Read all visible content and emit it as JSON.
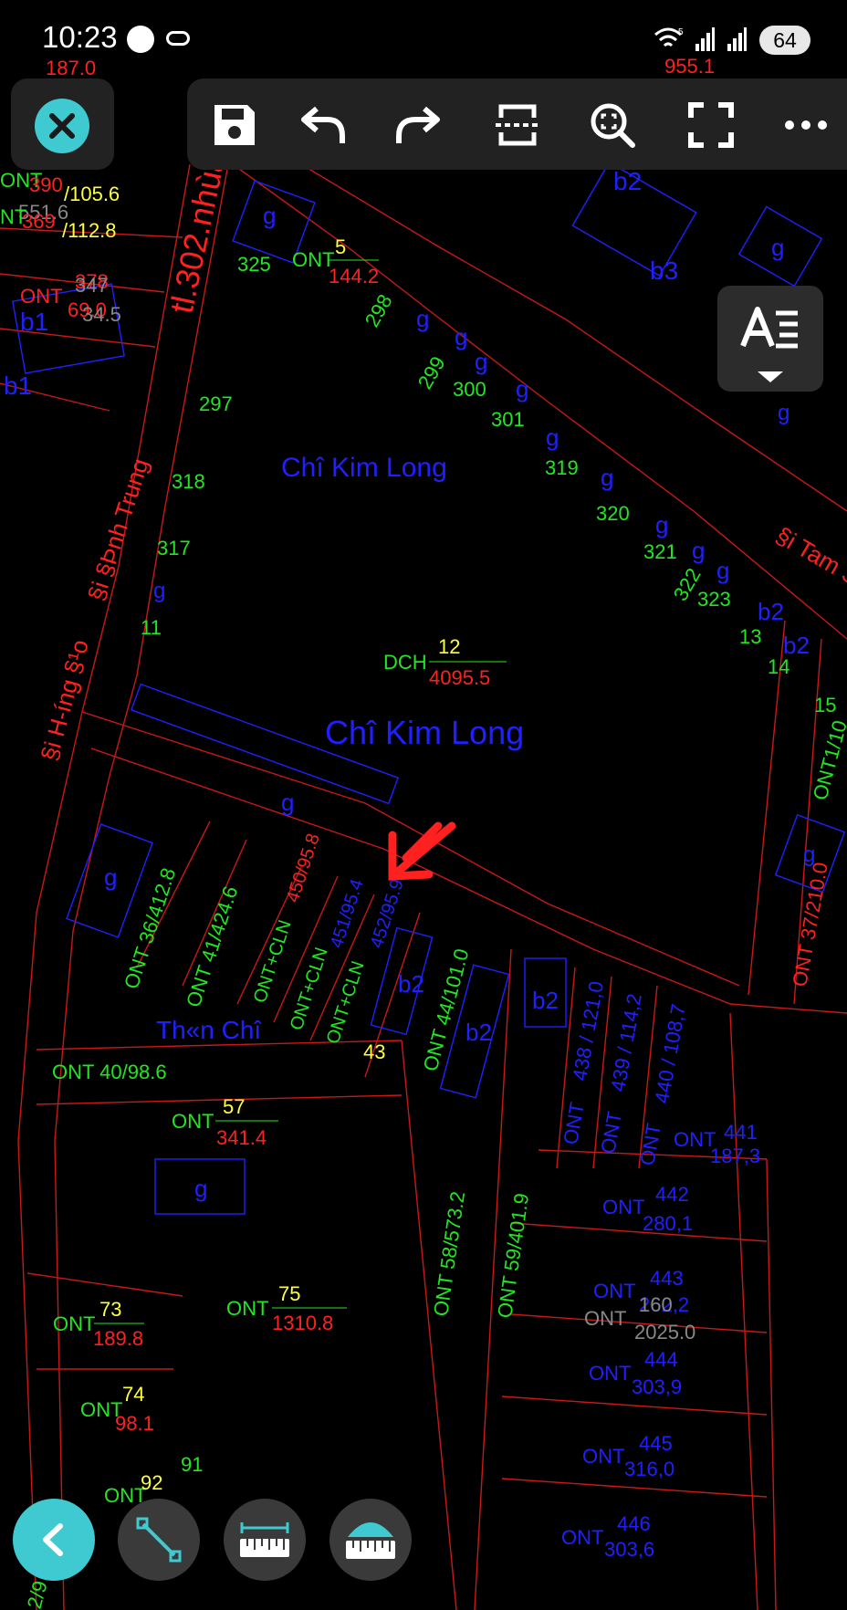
{
  "status_bar": {
    "time": "10:23",
    "battery": "64",
    "wifi_label": "5"
  },
  "toolbar": {
    "close": "close-icon",
    "save": "save-icon",
    "undo": "undo-icon",
    "redo": "redo-icon",
    "section": "section-icon",
    "zoom": "zoom-extents-icon",
    "fullscreen": "fullscreen-icon",
    "more": "more-icon"
  },
  "side_tools": {
    "text_style": "text-style-icon"
  },
  "bottom_tools": {
    "back": "back-icon",
    "line": "measure-line-icon",
    "distance": "measure-distance-icon",
    "area": "measure-area-icon"
  },
  "colors": {
    "accent": "#3fc9d0",
    "red_line": "#c81818",
    "blue": "#2020ff",
    "green": "#22e622",
    "red": "#ff2020",
    "yellow": "#ffff40"
  },
  "map": {
    "labels": {
      "top_cut_left": "187.0",
      "top_cut_right": "955.1",
      "ont_390": "ONT",
      "n390": "390",
      "a105": "/105.6",
      "n551": "551.6",
      "nt_left": "NT",
      "n369": "369",
      "a112": "/112.8",
      "ont_378": "ONT",
      "n378": "378",
      "n347": "347",
      "a69": "69.0",
      "n34_5": "34.5",
      "b1_a": "b1",
      "b1_b": "b1",
      "g_top": "g",
      "n325": "325",
      "ont5": "ONT",
      "n5": "5",
      "a144": "144.2",
      "road_302": "tl.302.nhùa",
      "n298": "298",
      "g298": "g",
      "n299": "299",
      "g299": "g",
      "n300": "300",
      "g300": "g",
      "n301": "301",
      "g301": "g",
      "n319": "319",
      "g319": "g",
      "n320": "320",
      "g320": "g",
      "n321": "321",
      "g321": "g",
      "n322": "322",
      "g322": "g",
      "n323": "323",
      "g323": "g",
      "b2_top": "b2",
      "b3": "b3",
      "g_b3": "g",
      "g_right": "g",
      "n297": "297",
      "chi_kim_long_1": "Chî Kim Long",
      "n318": "318",
      "n317": "317",
      "road_dinh_trung": "§i §Þnh Trung",
      "g11": "g",
      "n11": "11",
      "road_huong_dao": "§i H-íng §¹o",
      "dch": "DCH",
      "n12": "12",
      "a4095": "4095.5",
      "chi_kim_long_2": "Chî Kim Long",
      "road_tam": "§i Tam S",
      "b2_13": "b2",
      "n13": "13",
      "b2_14": "b2",
      "n14": "14",
      "n15": "15",
      "ont1_10": "ONT1/10",
      "g_strip": "g",
      "g_36": "g",
      "ont36": "ONT 36/412.8",
      "ont41": "ONT 41/424.6",
      "oc450": "ONT+CLN",
      "a450": "450/95.8",
      "oc451": "ONT+CLN",
      "a451": "451/95.4",
      "oc452": "ONT+CLN",
      "a452": "452/95.9",
      "b2_a": "b2",
      "ont44": "ONT 44/101.0",
      "b2_b": "b2",
      "b2_c": "b2",
      "n43": "43",
      "thon_chi": "Th«n Chî",
      "ont40": "ONT 40/98.6",
      "ont57": "ONT",
      "n57": "57",
      "a341": "341.4",
      "g57": "g",
      "ont438": "ONT",
      "a438": "438 / 121,0",
      "ont439": "ONT",
      "a439": "439 / 114,2",
      "ont440": "ONT",
      "a440": "440 / 108,7",
      "ont441": "ONT",
      "n441": "441",
      "a441": "187,3",
      "ont37": "ONT 37/210.0",
      "g37": "g",
      "ont442": "ONT",
      "n442": "442",
      "a442": "280,1",
      "ont443": "ONT",
      "n443": "443",
      "a443": "262,2",
      "ont_grey": "ONT",
      "n_grey": "160",
      "a_grey": "2025.0",
      "ont58": "ONT 58/573.2",
      "ont59": "ONT 59/401.9",
      "ont444": "ONT",
      "n444": "444",
      "a444": "303,9",
      "ont445": "ONT",
      "n445": "445",
      "a445": "316,0",
      "ont446": "ONT",
      "n446": "446",
      "a446": "303,6",
      "ont73": "ONT",
      "n73": "73",
      "a189": "189.8",
      "ont75": "ONT",
      "n75": "75",
      "a1310": "1310.8",
      "ont74": "ONT",
      "n74": "74",
      "a98": "98.1",
      "n91": "91",
      "ont92": "ONT",
      "n92": "92",
      "n_bottom_left": "2/9"
    }
  }
}
